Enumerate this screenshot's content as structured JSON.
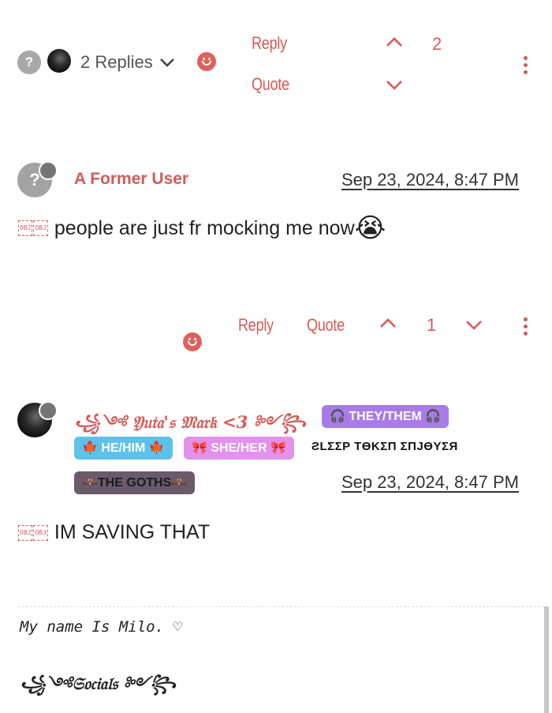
{
  "post1_footer": {
    "replies_label": "2 Replies",
    "reply_label": "Reply",
    "quote_label": "Quote",
    "vote_count": "2",
    "avatar_glyph": "?"
  },
  "post2": {
    "avatar_glyph": "?",
    "author": "A Former User",
    "timestamp": "Sep 23, 2024, 8:47 PM",
    "obj1": "OBJ",
    "obj2": "OBJ",
    "text": "people are just fr mocking me now",
    "emoji": "😭",
    "reply_label": "Reply",
    "quote_label": "Quote",
    "vote_count": "1"
  },
  "post3": {
    "username": "꧁༺ 𝔜𝔲𝔱𝔞'𝔰 𝔐𝔞𝔯𝔨 <3 ༻꧂",
    "badges": {
      "they": "🎧 THEY/THEM 🎧",
      "he": "🍁 HE/HIM 🍁",
      "she": "🎀 SHE/HER 🎀",
      "sleep": "ƧLΣΣP TӨKΣП ΣПJӨYΣЯ",
      "goths": "🦇THE GOTHS🦇"
    },
    "timestamp": "Sep 23, 2024, 8:47 PM",
    "obj1": "OBJ",
    "obj2": "OBJ",
    "text": "IM SAVING THAT"
  },
  "signature": {
    "line1": "My name Is Milo. ♡",
    "line2": "꧁༺𝔖𝔬𝔠𝔦𝔞𝔩𝔰 ༻꧂"
  },
  "colors": {
    "accent": "#d35b57",
    "badge_purple": "#a87be9",
    "badge_blue": "#5ec1ea",
    "badge_pink": "#e291ec",
    "badge_dark": "#6a5a6c"
  }
}
